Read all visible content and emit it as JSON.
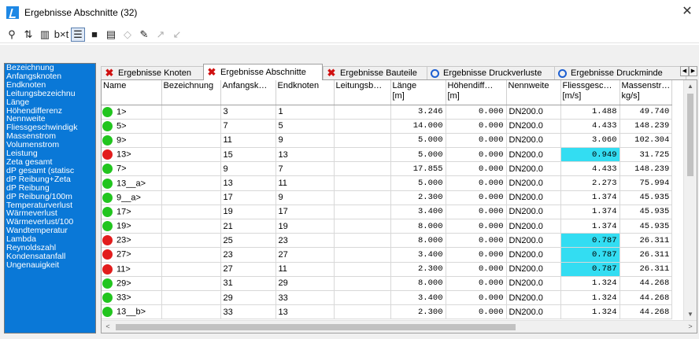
{
  "window": {
    "title": "Ergebnisse Abschnitte (32)",
    "close": "✕"
  },
  "toolbar": {
    "buttons": [
      {
        "name": "filter-icon",
        "glyph": "⚲"
      },
      {
        "name": "sort-icon",
        "glyph": "⇅"
      },
      {
        "name": "columns-icon",
        "glyph": "▥"
      },
      {
        "name": "text-format-icon",
        "glyph": "b×t"
      },
      {
        "name": "table-view-icon",
        "glyph": "☰"
      },
      {
        "name": "save-icon",
        "glyph": "■"
      },
      {
        "name": "print-icon",
        "glyph": "▤"
      },
      {
        "name": "eraser-icon",
        "glyph": "◇"
      },
      {
        "name": "pencil-icon",
        "glyph": "✎"
      },
      {
        "name": "arrow-up-right-icon",
        "glyph": "↗"
      },
      {
        "name": "arrow-down-left-icon",
        "glyph": "↙"
      }
    ]
  },
  "fields": [
    "Bezeichnung",
    "Anfangsknoten",
    "Endknoten",
    "Leitungsbezeichnu",
    "Länge",
    "Höhendifferenz",
    "Nennweite",
    "Fliessgeschwindigk",
    "Massenstrom",
    "Volumenstrom",
    "Leistung",
    "Zeta gesamt",
    "dP gesamt (statisc",
    "dP Reibung+Zeta",
    "dP Reibung",
    "dP Reibung/100m",
    "Temperaturverlust",
    "Wärmeverlust",
    "Wärmeverlust/100",
    "Wandtemperatur",
    "Lambda",
    "Reynoldszahl",
    "Kondensatanfall",
    "Ungenauigkeit"
  ],
  "tabs": [
    {
      "label": "Ergebnisse Knoten",
      "icon": "x"
    },
    {
      "label": "Ergebnisse Abschnitte",
      "icon": "x",
      "selected": true
    },
    {
      "label": "Ergebnisse Bauteile",
      "icon": "x"
    },
    {
      "label": "Ergebnisse Druckverluste",
      "icon": "o"
    },
    {
      "label": "Ergebnisse Druckminde",
      "icon": "o"
    }
  ],
  "tab_scroll": {
    "left": "◀",
    "right": "▶"
  },
  "table": {
    "columns": [
      "Name",
      "Bezeichnung",
      "Anfangsk…",
      "Endknoten",
      "Leitungsb…",
      "Länge\n[m]",
      "Höhendiff…\n[m]",
      "Nennweite",
      "Fliessgesc…\n[m/s]",
      "Massenstr…\nkg/s]"
    ],
    "rows": [
      {
        "status": "green",
        "name": "1>",
        "bez": "",
        "start": "3",
        "end": "1",
        "leit": "",
        "len": "3.246",
        "hd": "0.000",
        "dn": "DN200.0",
        "v": "1.488",
        "m": "49.740",
        "hl": false
      },
      {
        "status": "green",
        "name": "5>",
        "bez": "",
        "start": "7",
        "end": "5",
        "leit": "",
        "len": "14.000",
        "hd": "0.000",
        "dn": "DN200.0",
        "v": "4.433",
        "m": "148.239",
        "hl": false
      },
      {
        "status": "green",
        "name": "9>",
        "bez": "",
        "start": "11",
        "end": "9",
        "leit": "",
        "len": "5.000",
        "hd": "0.000",
        "dn": "DN200.0",
        "v": "3.060",
        "m": "102.304",
        "hl": false
      },
      {
        "status": "red",
        "name": "13>",
        "bez": "",
        "start": "15",
        "end": "13",
        "leit": "",
        "len": "5.000",
        "hd": "0.000",
        "dn": "DN200.0",
        "v": "0.949",
        "m": "31.725",
        "hl": true
      },
      {
        "status": "green",
        "name": "7>",
        "bez": "",
        "start": "9",
        "end": "7",
        "leit": "",
        "len": "17.855",
        "hd": "0.000",
        "dn": "DN200.0",
        "v": "4.433",
        "m": "148.239",
        "hl": false
      },
      {
        "status": "green",
        "name": "13__a>",
        "bez": "",
        "start": "13",
        "end": "11",
        "leit": "",
        "len": "5.000",
        "hd": "0.000",
        "dn": "DN200.0",
        "v": "2.273",
        "m": "75.994",
        "hl": false
      },
      {
        "status": "green",
        "name": "9__a>",
        "bez": "",
        "start": "17",
        "end": "9",
        "leit": "",
        "len": "2.300",
        "hd": "0.000",
        "dn": "DN200.0",
        "v": "1.374",
        "m": "45.935",
        "hl": false
      },
      {
        "status": "green",
        "name": "17>",
        "bez": "",
        "start": "19",
        "end": "17",
        "leit": "",
        "len": "3.400",
        "hd": "0.000",
        "dn": "DN200.0",
        "v": "1.374",
        "m": "45.935",
        "hl": false
      },
      {
        "status": "green",
        "name": "19>",
        "bez": "",
        "start": "21",
        "end": "19",
        "leit": "",
        "len": "8.000",
        "hd": "0.000",
        "dn": "DN200.0",
        "v": "1.374",
        "m": "45.935",
        "hl": false
      },
      {
        "status": "red",
        "name": "23>",
        "bez": "",
        "start": "25",
        "end": "23",
        "leit": "",
        "len": "8.000",
        "hd": "0.000",
        "dn": "DN200.0",
        "v": "0.787",
        "m": "26.311",
        "hl": true
      },
      {
        "status": "red",
        "name": "27>",
        "bez": "",
        "start": "23",
        "end": "27",
        "leit": "",
        "len": "3.400",
        "hd": "0.000",
        "dn": "DN200.0",
        "v": "0.787",
        "m": "26.311",
        "hl": true
      },
      {
        "status": "red",
        "name": "11>",
        "bez": "",
        "start": "27",
        "end": "11",
        "leit": "",
        "len": "2.300",
        "hd": "0.000",
        "dn": "DN200.0",
        "v": "0.787",
        "m": "26.311",
        "hl": true
      },
      {
        "status": "green",
        "name": "29>",
        "bez": "",
        "start": "31",
        "end": "29",
        "leit": "",
        "len": "8.000",
        "hd": "0.000",
        "dn": "DN200.0",
        "v": "1.324",
        "m": "44.268",
        "hl": false
      },
      {
        "status": "green",
        "name": "33>",
        "bez": "",
        "start": "29",
        "end": "33",
        "leit": "",
        "len": "3.400",
        "hd": "0.000",
        "dn": "DN200.0",
        "v": "1.324",
        "m": "44.268",
        "hl": false
      },
      {
        "status": "green",
        "name": "13__b>",
        "bez": "",
        "start": "33",
        "end": "13",
        "leit": "",
        "len": "2.300",
        "hd": "0.000",
        "dn": "DN200.0",
        "v": "1.324",
        "m": "44.268",
        "hl": false
      }
    ]
  },
  "scroll": {
    "up": "▲",
    "down": "▼",
    "left": "<",
    "right": ">"
  },
  "colors": {
    "field_list_bg": "#0a78d7",
    "status_ok": "#22c51f",
    "status_error": "#e21d1d",
    "highlight": "#33ddf2"
  }
}
